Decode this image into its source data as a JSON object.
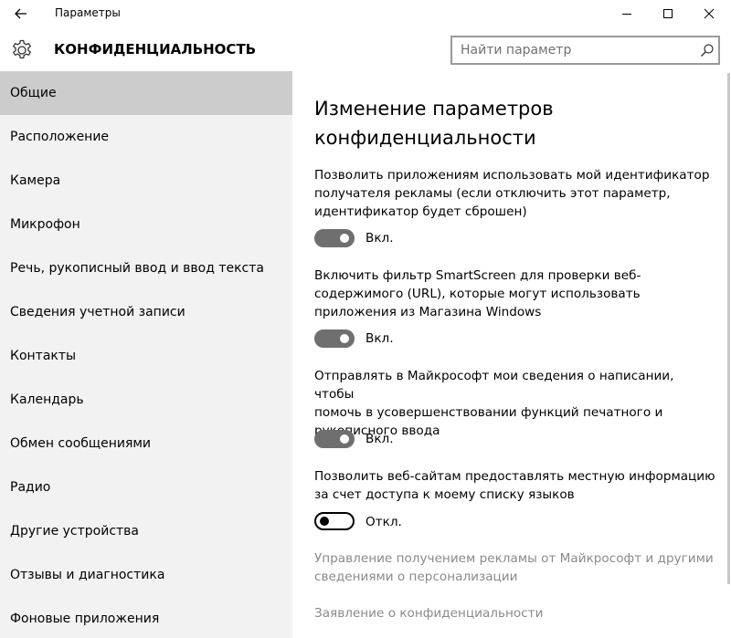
{
  "window": {
    "title": "Параметры",
    "controls": {
      "minimize": "—",
      "maximize": "☐",
      "close": "✕"
    }
  },
  "header": {
    "section_title": "КОНФИДЕНЦИАЛЬНОСТЬ",
    "search_placeholder": "Найти параметр"
  },
  "sidebar": {
    "items": [
      {
        "label": "Общие",
        "active": true
      },
      {
        "label": "Расположение",
        "active": false
      },
      {
        "label": "Камера",
        "active": false
      },
      {
        "label": "Микрофон",
        "active": false
      },
      {
        "label": "Речь, рукописный ввод и ввод текста",
        "active": false
      },
      {
        "label": "Сведения учетной записи",
        "active": false
      },
      {
        "label": "Контакты",
        "active": false
      },
      {
        "label": "Календарь",
        "active": false
      },
      {
        "label": "Обмен сообщениями",
        "active": false
      },
      {
        "label": "Радио",
        "active": false
      },
      {
        "label": "Другие устройства",
        "active": false
      },
      {
        "label": "Отзывы и диагностика",
        "active": false
      },
      {
        "label": "Фоновые приложения",
        "active": false
      }
    ]
  },
  "main": {
    "heading_line1": "Изменение параметров",
    "heading_line2": "конфиденциальности",
    "settings": [
      {
        "lines": [
          "Позволить приложениям использовать мой идентификатор",
          "получателя рекламы (если отключить этот параметр,",
          "идентификатор будет сброшен)"
        ],
        "state": "on",
        "state_label": "Вкл."
      },
      {
        "lines": [
          "Включить фильтр SmartScreen для проверки веб-",
          "содержимого (URL), которые могут использовать",
          "приложения из Магазина Windows"
        ],
        "state": "on",
        "state_label": "Вкл."
      },
      {
        "lines": [
          "Отправлять в Майкрософт мои сведения о написании, чтобы",
          "помочь в усовершенствовании функций печатного и",
          "рукописного ввода"
        ],
        "state": "on",
        "state_label": "Вкл."
      },
      {
        "lines": [
          "Позволить веб-сайтам предоставлять местную информацию",
          "за счет доступа к моему списку языков"
        ],
        "state": "off",
        "state_label": "Откл."
      }
    ],
    "links": {
      "ads_line1": "Управление получением рекламы от Майкрософт и другими",
      "ads_line2": "сведениями о персонализации",
      "privacy_statement": "Заявление о конфиденциальности"
    }
  },
  "colors": {
    "sidebar_bg": "#f2f2f2",
    "sidebar_active": "#cccccc",
    "toggle_on": "#6f6f6f",
    "link": "#8a8a8a"
  }
}
